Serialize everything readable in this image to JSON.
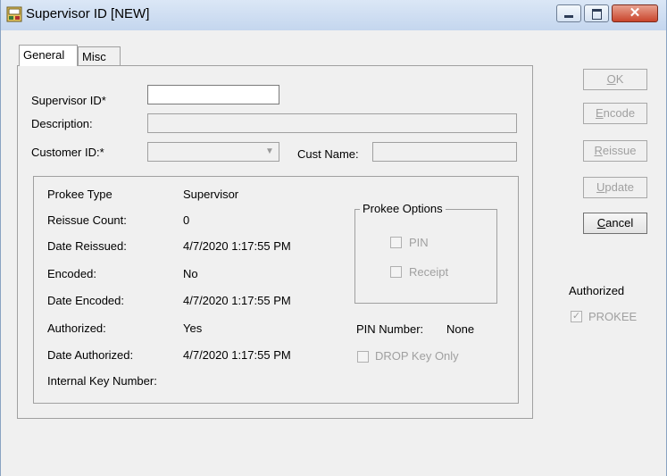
{
  "window": {
    "title": "Supervisor ID  [NEW]",
    "close_glyph": "✕"
  },
  "tabs": [
    {
      "label": "General"
    },
    {
      "label": "Misc"
    }
  ],
  "form": {
    "supervisor_id_label": "Supervisor ID*",
    "supervisor_id_value": "",
    "description_label": "Description:",
    "description_value": "",
    "customer_id_label": "Customer ID:*",
    "customer_id_value": "",
    "cust_name_label": "Cust Name:",
    "cust_name_value": ""
  },
  "details": {
    "prokee_type_label": "Prokee Type",
    "prokee_type_value": "Supervisor",
    "reissue_count_label": "Reissue Count:",
    "reissue_count_value": "0",
    "date_reissued_label": "Date Reissued:",
    "date_reissued_value": "4/7/2020 1:17:55 PM",
    "encoded_label": "Encoded:",
    "encoded_value": "No",
    "date_encoded_label": "Date Encoded:",
    "date_encoded_value": "4/7/2020 1:17:55 PM",
    "authorized_label": "Authorized:",
    "authorized_value": "Yes",
    "date_authorized_label": "Date Authorized:",
    "date_authorized_value": "4/7/2020 1:17:55 PM",
    "internal_key_label": "Internal Key Number:",
    "internal_key_value": ""
  },
  "prokee_options": {
    "title": "Prokee Options",
    "pin_label": "PIN",
    "receipt_label": "Receipt",
    "pin_checked": false,
    "receipt_checked": false
  },
  "pin_number_label": "PIN Number:",
  "pin_number_value": "None",
  "drop_key_only_label": "DROP Key Only",
  "buttons": {
    "ok_first": "O",
    "ok_rest": "K",
    "encode_first": "E",
    "encode_rest": "ncode",
    "reissue_first": "R",
    "reissue_rest": "eissue",
    "update_first": "U",
    "update_rest": "pdate",
    "cancel_first": "C",
    "cancel_rest": "ancel"
  },
  "authorized_section": {
    "label": "Authorized",
    "prokee_label": "PROKEE",
    "prokee_checked": true,
    "check_glyph": "✓"
  },
  "icons": {
    "app": "app-icon",
    "minimize": "minimize-icon",
    "maximize": "maximize-icon",
    "close": "close-icon",
    "dropdown": "chevron-down-icon"
  },
  "colors": {
    "titlebar": "#c4d6ee",
    "close_button": "#c9452c",
    "disabled_text": "#a0a0a0"
  }
}
